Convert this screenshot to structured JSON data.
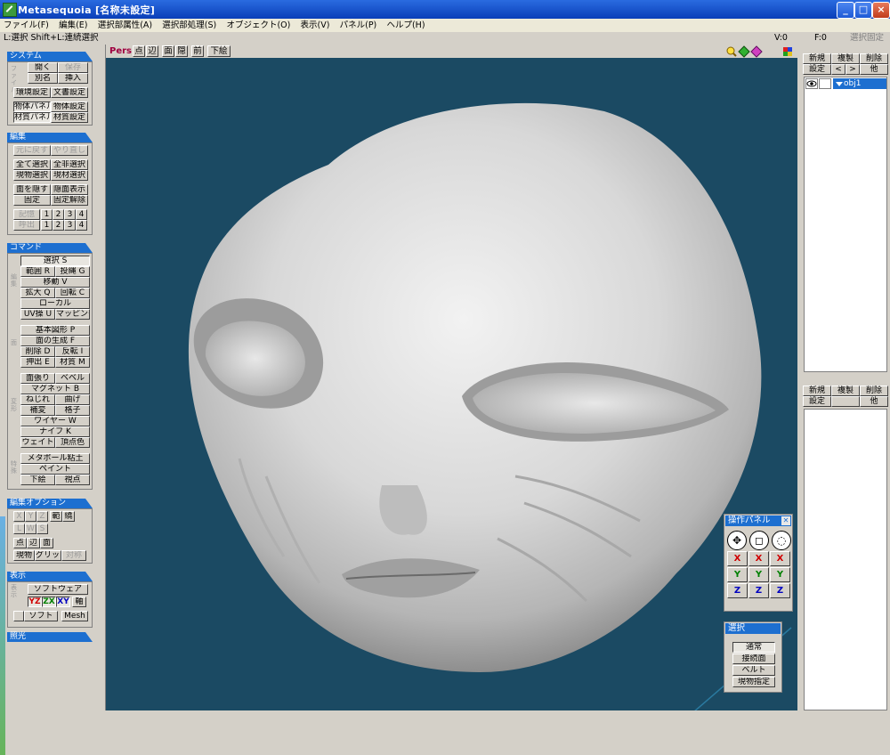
{
  "window": {
    "title": "Metasequoia [名称未設定]",
    "min": "_",
    "max": "□",
    "close": "×"
  },
  "menu": [
    "ファイル(F)",
    "編集(E)",
    "選択部属性(A)",
    "選択部処理(S)",
    "オブジェクト(O)",
    "表示(V)",
    "パネル(P)",
    "ヘルプ(H)"
  ],
  "status": {
    "hint": "L:選択  Shift+L:連続選択",
    "v": "V:0",
    "f": "F:0",
    "fix": "選択固定"
  },
  "left": {
    "system": {
      "title": "システム",
      "vlabel": "ファイル",
      "open": "開く",
      "save": "保存",
      "saveas": "別名",
      "insert": "挿入",
      "env": "環境設定",
      "doc": "文書設定",
      "objpanel": "物体パネル",
      "objset": "物体設定",
      "matpanel": "材質パネル",
      "matset": "材質設定"
    },
    "edit": {
      "title": "編集",
      "undo": "元に戻す",
      "redo": "やり直し",
      "selall": "全て選択",
      "deselall": "全非選択",
      "selobj": "現物選択",
      "selmat": "現材選択",
      "hide": "面を隠す",
      "show": "隠面表示",
      "fix": "固定",
      "unfix": "固定解除",
      "mem": "記憶",
      "recall": "呼出",
      "n1": "1",
      "n2": "2",
      "n3": "3",
      "n4": "4"
    },
    "command": {
      "title": "コマンド",
      "vl1": "編集",
      "vl2": "面",
      "vl3": "変形",
      "vl4": "特殊",
      "select": "選択 S",
      "range": "範囲 R",
      "lasso": "投縄 G",
      "move": "移動 V",
      "scale": "拡大 Q",
      "rotate": "回転 C",
      "local": "ローカル",
      "uv": "UV操 U",
      "mapping": "マッピング",
      "primitive": "基本図形 P",
      "genface": "面の生成 F",
      "delete": "削除 D",
      "flip": "反転 I",
      "extrude": "押出 E",
      "material": "材質 M",
      "facefill": "面張り",
      "bevel": "ベベル",
      "magnet": "マグネット B",
      "twist": "ねじれ",
      "bend": "曲げ",
      "sculpt": "補変",
      "lattice": "格子",
      "wire": "ワイヤー W",
      "knife": "ナイフ K",
      "weld": "ウェイト",
      "vcolor": "頂点色",
      "metaball": "メタボール粘土",
      "paint": "ペイント",
      "underlay": "下絵",
      "viewpoint": "視点"
    },
    "editopt": {
      "title": "編集オプション",
      "x": "X",
      "y": "Y",
      "z": "Z",
      "range": "範",
      "around": "繞",
      "l": "L",
      "w": "W",
      "s": "S",
      "point": "点",
      "edge": "辺",
      "face": "面",
      "curobj": "現物",
      "grid": "グリッド",
      "sym": "対称"
    },
    "display": {
      "title": "表示",
      "vlabel": "表示",
      "software": "ソフトウェア",
      "yz": "YZ",
      "zx": "ZX",
      "xy": "XY",
      "axis": "軸",
      "soft": "ソフト",
      "mesh": "Mesh"
    },
    "light": {
      "title": "照光"
    }
  },
  "viewport": {
    "pers": "Pers",
    "pt": "点",
    "edge": "辺",
    "face": "面",
    "hidden": "隠",
    "front": "前",
    "underlay": "下絵"
  },
  "right": {
    "obj": {
      "new": "新規",
      "dup": "複製",
      "del": "削除",
      "set": "設定",
      "prev": "<",
      "next": ">",
      "other": "他",
      "item": "obj1"
    },
    "mat": {
      "new": "新規",
      "dup": "複製",
      "del": "削除",
      "set": "設定",
      "other": "他"
    }
  },
  "op_panel": {
    "title": "操作パネル",
    "x": "X",
    "y": "Y",
    "z": "Z"
  },
  "sel_panel": {
    "title": "選択",
    "normal": "通常",
    "connected": "接続面",
    "belt": "ベルト",
    "curobj": "現物指定"
  },
  "colors": {
    "viewport_bg": "#1b4a63",
    "accent": "#1d6fd0",
    "x_axis": "#d00000",
    "y_axis": "#008000",
    "z_axis": "#0000c0"
  }
}
